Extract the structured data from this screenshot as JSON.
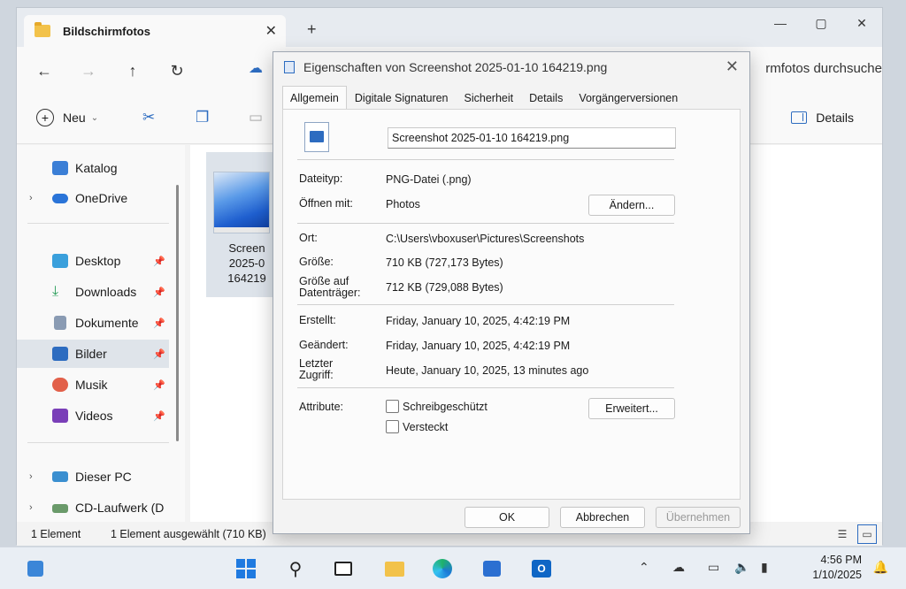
{
  "explorer": {
    "tab_title": "Bildschirmfotos",
    "new_tab": "+",
    "search_hint": "rmfotos durchsuche",
    "toolbar": {
      "new_label": "Neu",
      "details_label": "Details"
    },
    "sidebar": {
      "items": [
        {
          "label": "Katalog",
          "icon": "gallery-icon"
        },
        {
          "label": "OneDrive",
          "icon": "onedrive-icon"
        },
        {
          "label": "Desktop",
          "icon": "desktop-icon"
        },
        {
          "label": "Downloads",
          "icon": "downloads-icon"
        },
        {
          "label": "Dokumente",
          "icon": "documents-icon"
        },
        {
          "label": "Bilder",
          "icon": "pictures-icon"
        },
        {
          "label": "Musik",
          "icon": "music-icon"
        },
        {
          "label": "Videos",
          "icon": "videos-icon"
        },
        {
          "label": "Dieser PC",
          "icon": "pc-icon"
        },
        {
          "label": "CD-Laufwerk (D",
          "icon": "cd-drive-icon"
        }
      ]
    },
    "file": {
      "name_line1": "Screen",
      "name_line2": "2025-0",
      "name_line3": "164219"
    },
    "status": {
      "count": "1 Element",
      "selected": "1 Element ausgewählt (710 KB)"
    }
  },
  "dialog": {
    "title": "Eigenschaften von Screenshot 2025-01-10 164219.png",
    "tabs": [
      "Allgemein",
      "Digitale Signaturen",
      "Sicherheit",
      "Details",
      "Vorgängerversionen"
    ],
    "filename": "Screenshot 2025-01-10 164219.png",
    "props": {
      "type_label": "Dateityp:",
      "type_value": "PNG-Datei (.png)",
      "open_label": "Öffnen mit:",
      "open_value": "Photos",
      "change_button": "Ändern...",
      "location_label": "Ort:",
      "location_value": "C:\\Users\\vboxuser\\Pictures\\Screenshots",
      "size_label": "Größe:",
      "size_value": "710 KB (727,173 Bytes)",
      "disk_label_1": "Größe auf",
      "disk_label_2": "Datenträger:",
      "disk_value": "712 KB (729,088 Bytes)",
      "created_label": "Erstellt:",
      "created_value": "Friday, January 10, 2025, 4:42:19 PM",
      "modified_label": "Geändert:",
      "modified_value": "Friday, January 10, 2025, 4:42:19 PM",
      "accessed_label_1": "Letzter",
      "accessed_label_2": "Zugriff:",
      "accessed_value": "Heute, January 10, 2025, 13 minutes ago",
      "attributes_label": "Attribute:",
      "readonly_label": "Schreibgeschützt",
      "hidden_label": "Versteckt",
      "advanced_button": "Erweitert..."
    },
    "footer": {
      "ok": "OK",
      "cancel": "Abbrechen",
      "apply": "Übernehmen"
    }
  },
  "taskbar": {
    "time": "4:56 PM",
    "date": "1/10/2025"
  }
}
